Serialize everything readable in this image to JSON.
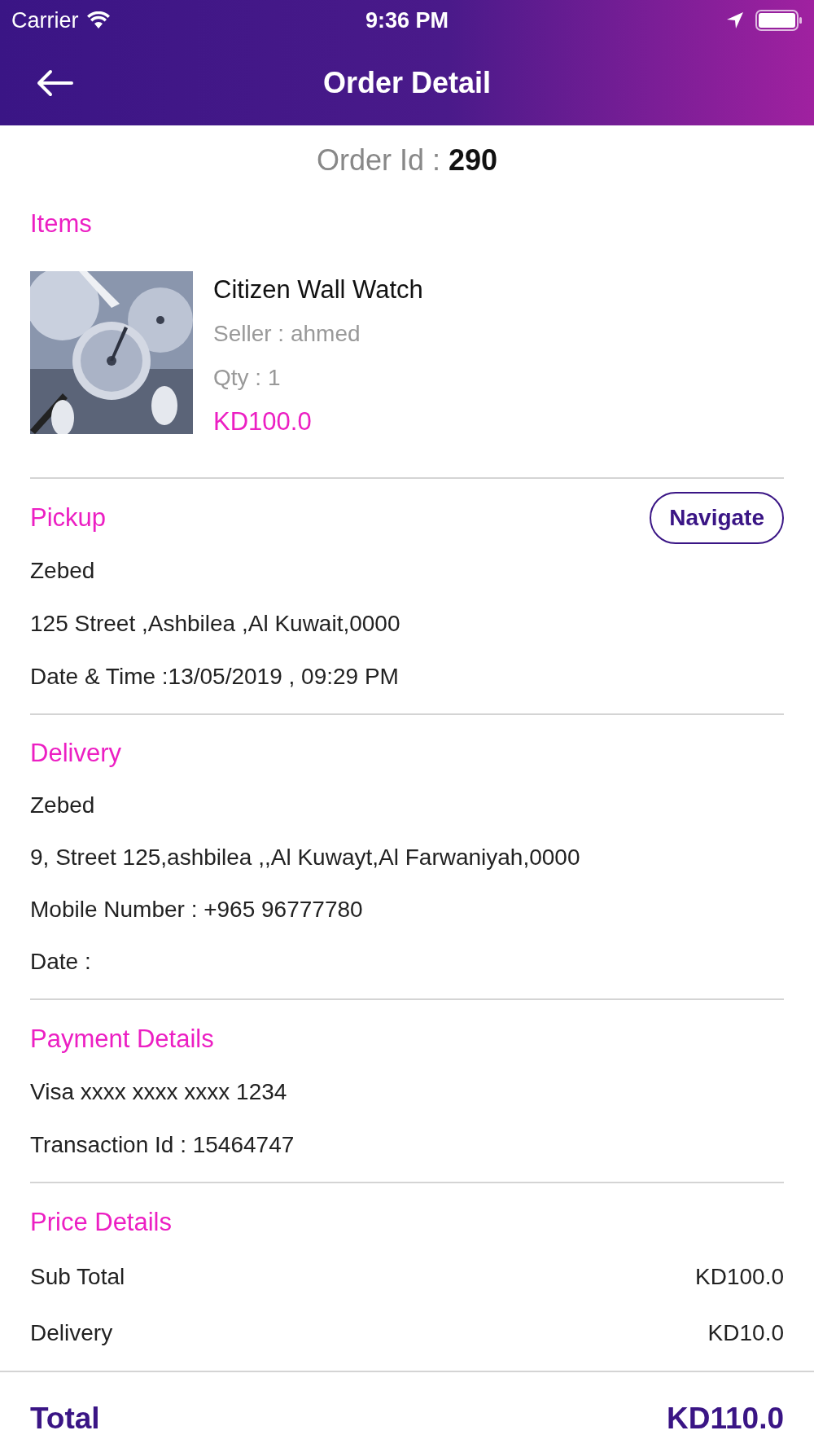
{
  "status_bar": {
    "carrier": "Carrier",
    "time": "9:36 PM"
  },
  "header": {
    "title": "Order Detail"
  },
  "order_id": {
    "label": "Order Id :",
    "value": "290"
  },
  "items": {
    "title": "Items",
    "list": [
      {
        "kind": "picture",
        "name": "Citizen Wall Watch",
        "seller": "Seller : ahmed",
        "qty": "Qty : 1",
        "price": "KD100.0"
      }
    ]
  },
  "pickup": {
    "title": "Pickup",
    "button": "Navigate",
    "lines": [
      "Zebed",
      "125 Street ,Ashbilea ,Al Kuwait,0000",
      "Date & Time :13/05/2019 , 09:29 PM"
    ]
  },
  "delivery": {
    "title": "Delivery",
    "lines": [
      "Zebed",
      "9, Street 125,ashbilea ,,Al Kuwayt,Al Farwaniyah,0000",
      "Mobile Number : +965 96777780",
      "Date :"
    ]
  },
  "payment": {
    "title": "Payment Details",
    "lines": [
      "Visa xxxx xxxx xxxx 1234",
      "Transaction Id : 15464747"
    ]
  },
  "price_details": {
    "title": "Price Details",
    "rows": [
      {
        "label": "Sub Total",
        "value": "KD100.0"
      },
      {
        "label": "Delivery",
        "value": "KD10.0"
      }
    ]
  },
  "total": {
    "label": "Total",
    "value": "KD110.0"
  }
}
